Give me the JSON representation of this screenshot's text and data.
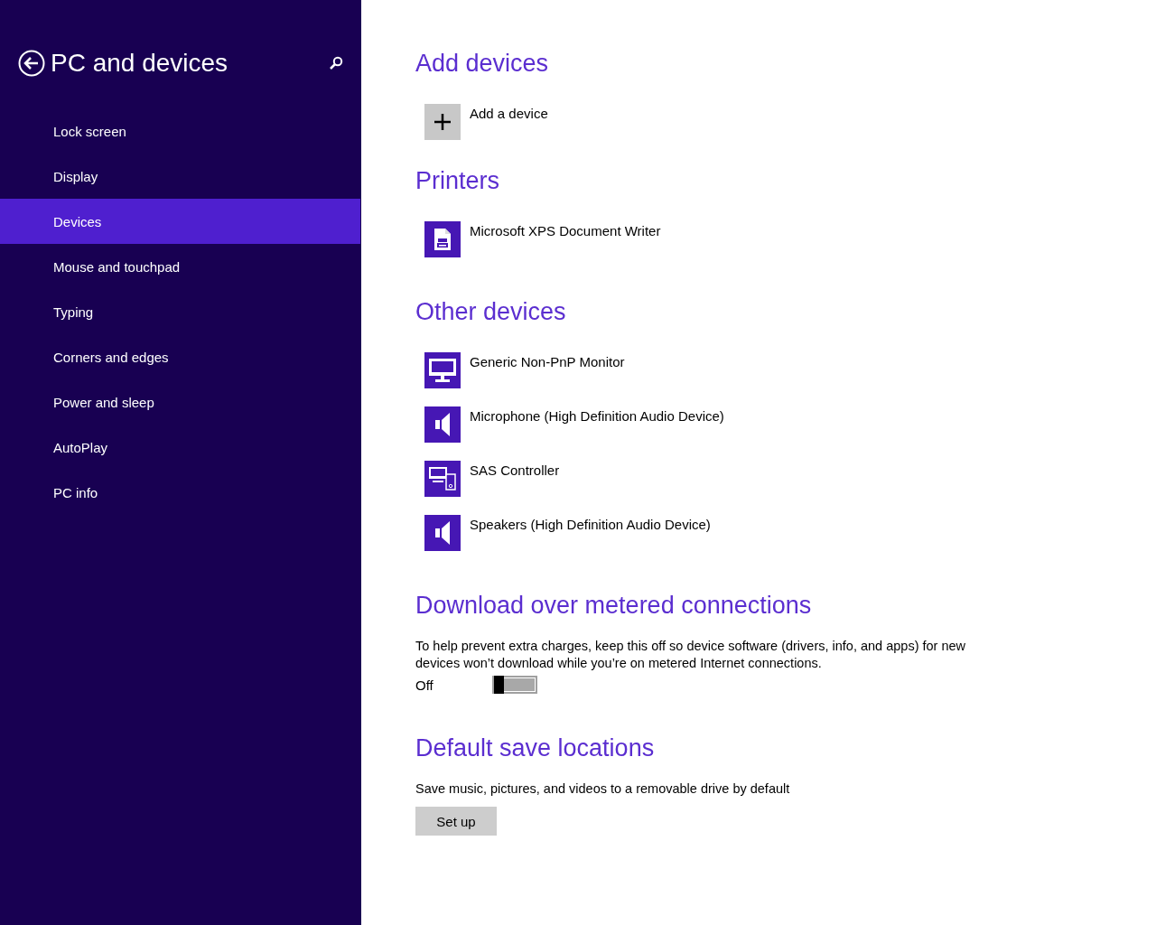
{
  "sidebar": {
    "title": "PC and devices",
    "items": [
      {
        "label": "Lock screen",
        "selected": false
      },
      {
        "label": "Display",
        "selected": false
      },
      {
        "label": "Devices",
        "selected": true
      },
      {
        "label": "Mouse and touchpad",
        "selected": false
      },
      {
        "label": "Typing",
        "selected": false
      },
      {
        "label": "Corners and edges",
        "selected": false
      },
      {
        "label": "Power and sleep",
        "selected": false
      },
      {
        "label": "AutoPlay",
        "selected": false
      },
      {
        "label": "PC info",
        "selected": false
      }
    ]
  },
  "sections": [
    {
      "kind": "devices",
      "heading": "Add devices",
      "devices": [
        {
          "label": "Add a device",
          "kind": "add"
        }
      ]
    },
    {
      "kind": "devices",
      "heading": "Printers",
      "devices": [
        {
          "label": "Microsoft XPS Document Writer",
          "kind": "printer"
        }
      ]
    },
    {
      "kind": "devices",
      "heading": "Other devices",
      "devices": [
        {
          "label": "Generic Non-PnP Monitor",
          "kind": "monitor"
        },
        {
          "label": "Microphone (High Definition Audio Device)",
          "kind": "speaker"
        },
        {
          "label": "SAS Controller",
          "kind": "devices"
        },
        {
          "label": "Speakers (High Definition Audio Device)",
          "kind": "speaker"
        }
      ]
    },
    {
      "kind": "toggle",
      "heading": "Download over metered connections",
      "text": "To help prevent extra charges, keep this off so device software (drivers, info, and apps) for new devices won’t download while you’re on metered Internet connections.",
      "state_label": "Off",
      "on": false
    },
    {
      "kind": "button",
      "heading": "Default save locations",
      "text": "Save music, pictures, and videos to a removable drive by default",
      "button": "Set up"
    }
  ]
}
